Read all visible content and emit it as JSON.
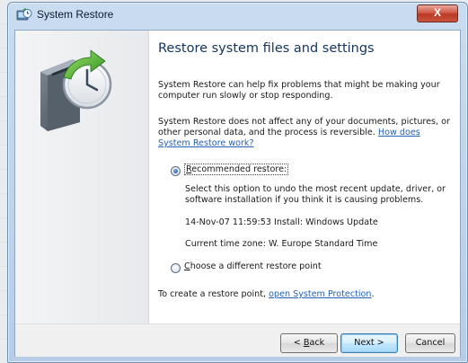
{
  "window": {
    "title": "System Restore",
    "close_label": "X"
  },
  "main": {
    "heading": "Restore system files and settings",
    "intro": "System Restore can help fix problems that might be making your computer run slowly or stop responding.",
    "note_text": "System Restore does not affect any of your documents, pictures, or other personal data, and the process is reversible.",
    "note_link": "How does System Restore work?",
    "recommended": {
      "label_accel": "R",
      "label_rest": "ecommended restore:",
      "selected": true,
      "description": "Select this option to undo the most recent update, driver, or software installation if you think it is causing problems.",
      "restore_point": "14-Nov-07 11:59:53 Install: Windows Update",
      "timezone": "Current time zone: W. Europe Standard Time"
    },
    "choose": {
      "label_accel": "C",
      "label_rest": "hoose a different restore point",
      "selected": false
    },
    "create_text": "To create a restore point,",
    "create_link": "open System Protection",
    "create_end": "."
  },
  "footer": {
    "back_prefix": "< ",
    "back_accel": "B",
    "back_rest": "ack",
    "next_label": "Next >",
    "cancel_label": "Cancel"
  },
  "icons": {
    "title": "system-restore-icon",
    "hero": "system-restore-clock-icon"
  }
}
